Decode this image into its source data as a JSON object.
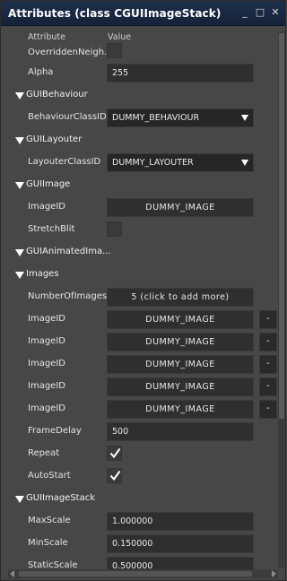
{
  "window": {
    "title": "Attributes  (class CGUIImageStack)",
    "minimize": "_",
    "maximize": "□",
    "close": "✕"
  },
  "header": {
    "attribute": "Attribute",
    "value": "Value"
  },
  "rows": {
    "overridden": {
      "label": "OverriddenNeigh..."
    },
    "alpha": {
      "label": "Alpha",
      "value": "255"
    },
    "guibehaviour": {
      "label": "GUIBehaviour"
    },
    "behaviourclassid": {
      "label": "BehaviourClassID",
      "value": "DUMMY_BEHAVIOUR"
    },
    "guilayouter": {
      "label": "GUILayouter"
    },
    "layouterclassid": {
      "label": "LayouterClassID",
      "value": "DUMMY_LAYOUTER"
    },
    "guiimage": {
      "label": "GUIImage"
    },
    "imageid": {
      "label": "ImageID",
      "value": "DUMMY_IMAGE"
    },
    "stretchblit": {
      "label": "StretchBlit"
    },
    "guianimated": {
      "label": "GUIAnimatedIma..."
    },
    "images": {
      "label": "Images"
    },
    "numberofimages": {
      "label": "NumberOfImages",
      "value": "5 (click to add more)"
    },
    "imgs": [
      {
        "label": "ImageID",
        "value": "DUMMY_IMAGE",
        "remove": "-"
      },
      {
        "label": "ImageID",
        "value": "DUMMY_IMAGE",
        "remove": "-"
      },
      {
        "label": "ImageID",
        "value": "DUMMY_IMAGE",
        "remove": "-"
      },
      {
        "label": "ImageID",
        "value": "DUMMY_IMAGE",
        "remove": "-"
      },
      {
        "label": "ImageID",
        "value": "DUMMY_IMAGE",
        "remove": "-"
      }
    ],
    "framedelay": {
      "label": "FrameDelay",
      "value": "500"
    },
    "repeat": {
      "label": "Repeat",
      "checked": true
    },
    "autostart": {
      "label": "AutoStart",
      "checked": true
    },
    "guiimagestack": {
      "label": "GUIImageStack"
    },
    "maxscale": {
      "label": "MaxScale",
      "value": "1.000000"
    },
    "minscale": {
      "label": "MinScale",
      "value": "0.150000"
    },
    "staticscale": {
      "label": "StaticScale",
      "value": "0.500000"
    }
  }
}
